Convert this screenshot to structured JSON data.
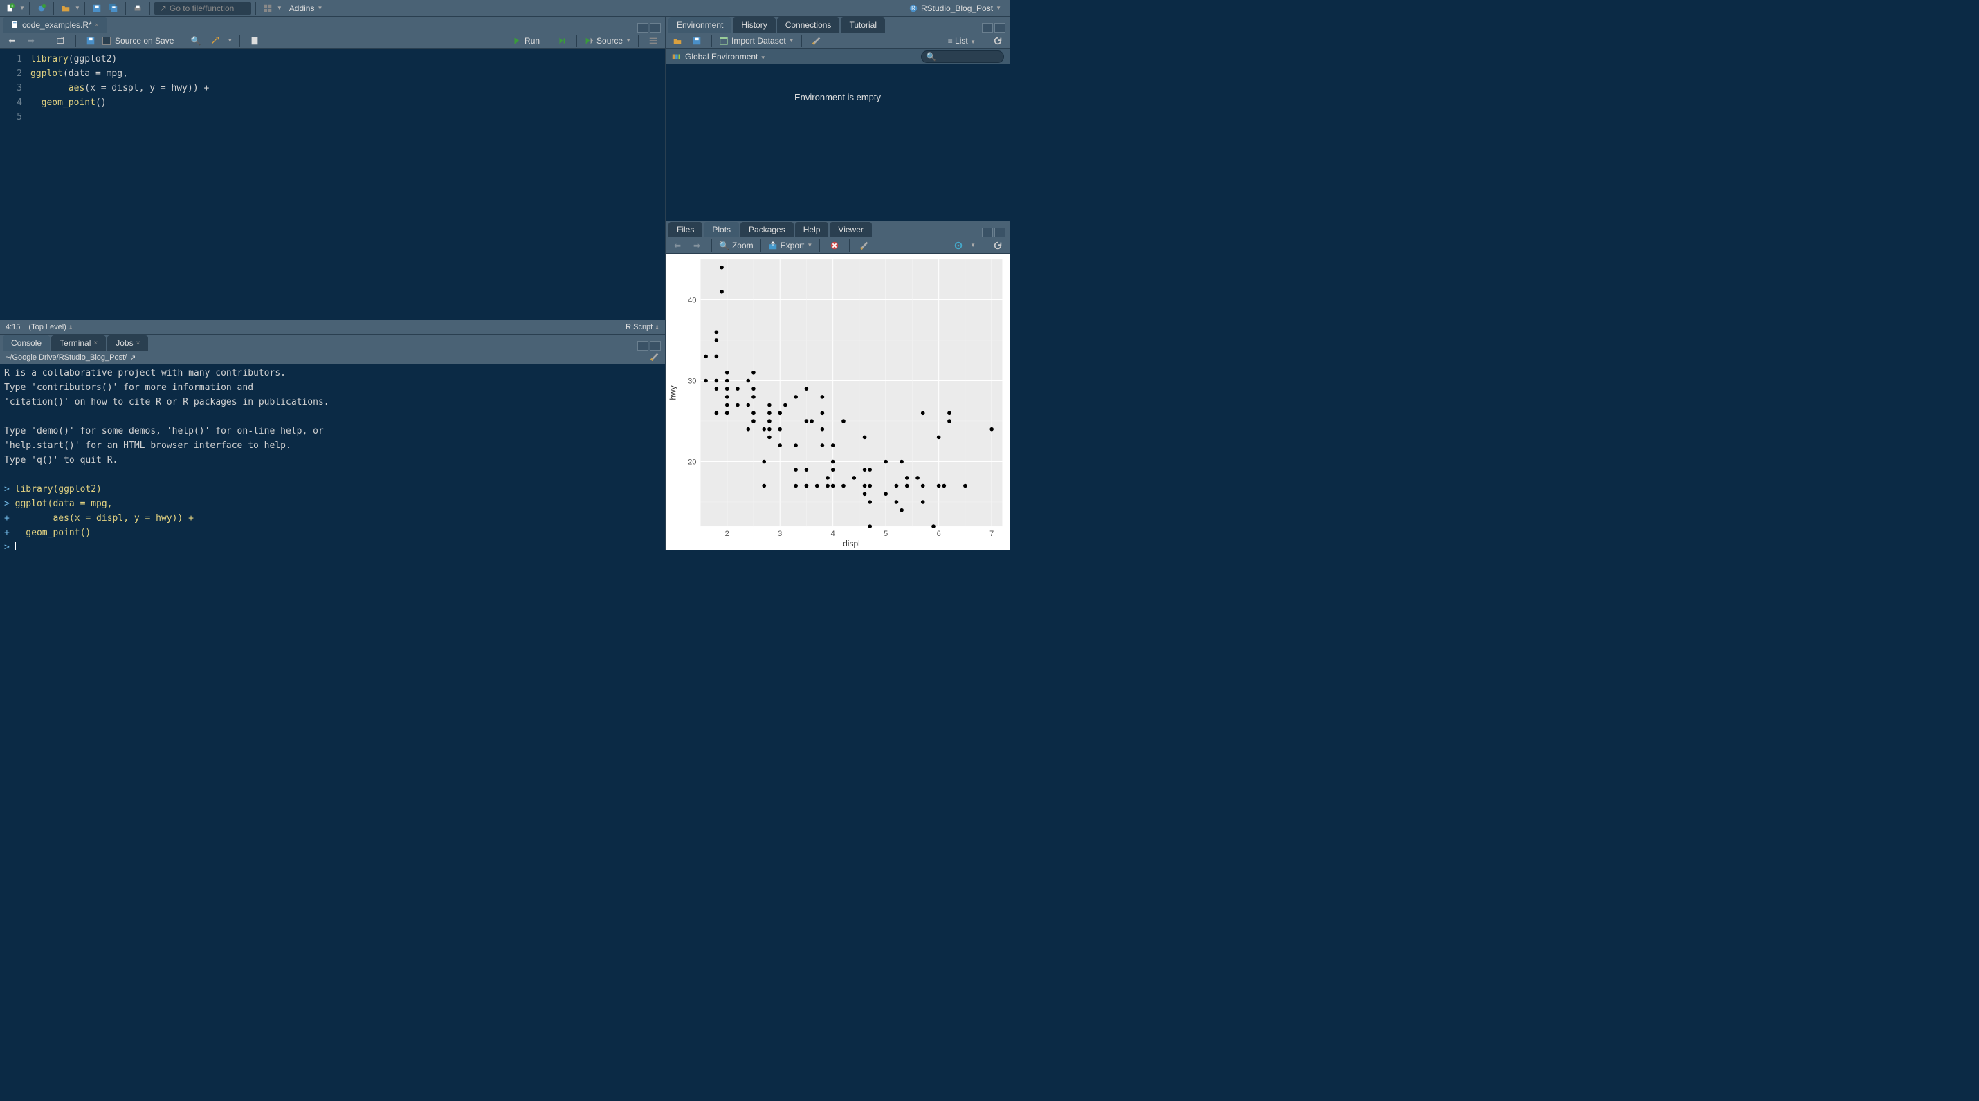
{
  "project": {
    "name": "RStudio_Blog_Post"
  },
  "main_toolbar": {
    "goto_placeholder": "Go to file/function",
    "addins_label": "Addins"
  },
  "source": {
    "tab_label": "code_examples.R*",
    "source_on_save": "Source on Save",
    "run_label": "Run",
    "source_label": "Source",
    "status_pos": "4:15",
    "status_scope": "(Top Level)",
    "status_type": "R Script",
    "lines": [
      {
        "n": 1,
        "tokens": [
          [
            "fn",
            "library"
          ],
          [
            "op",
            "("
          ],
          [
            "d",
            "ggplot2"
          ],
          [
            "op",
            ")"
          ]
        ]
      },
      {
        "n": 2,
        "tokens": [
          [
            "fn",
            "ggplot"
          ],
          [
            "op",
            "("
          ],
          [
            "d",
            "data "
          ],
          [
            "op",
            "="
          ],
          [
            "d",
            " mpg"
          ],
          [
            "op",
            ","
          ]
        ]
      },
      {
        "n": 3,
        "tokens": [
          [
            "d",
            "       "
          ],
          [
            "fn",
            "aes"
          ],
          [
            "op",
            "("
          ],
          [
            "d",
            "x "
          ],
          [
            "op",
            "="
          ],
          [
            "d",
            " displ"
          ],
          [
            "op",
            ","
          ],
          [
            "d",
            " y "
          ],
          [
            "op",
            "="
          ],
          [
            "d",
            " hwy"
          ],
          [
            "op",
            "))"
          ],
          [
            "d",
            " "
          ],
          [
            "op",
            "+"
          ]
        ]
      },
      {
        "n": 4,
        "tokens": [
          [
            "d",
            "  "
          ],
          [
            "fn",
            "geom_point"
          ],
          [
            "op",
            "()"
          ]
        ]
      },
      {
        "n": 5,
        "tokens": []
      }
    ]
  },
  "console": {
    "tabs": [
      "Console",
      "Terminal",
      "Jobs"
    ],
    "path": "~/Google Drive/RStudio_Blog_Post/",
    "body_plain": "R is a collaborative project with many contributors.\nType 'contributors()' for more information and\n'citation()' on how to cite R or R packages in publications.\n\nType 'demo()' for some demos, 'help()' for on-line help, or\n'help.start()' for an HTML browser interface to help.\nType 'q()' to quit R.\n",
    "cmds": [
      {
        "p": ">",
        "t": "library(ggplot2)"
      },
      {
        "p": ">",
        "t": "ggplot(data = mpg,"
      },
      {
        "p": "+",
        "t": "       aes(x = displ, y = hwy)) +"
      },
      {
        "p": "+",
        "t": "  geom_point()"
      }
    ]
  },
  "env": {
    "tabs": [
      "Environment",
      "History",
      "Connections",
      "Tutorial"
    ],
    "import_label": "Import Dataset",
    "list_label": "List",
    "scope": "Global Environment",
    "empty_msg": "Environment is empty"
  },
  "plots": {
    "tabs": [
      "Files",
      "Plots",
      "Packages",
      "Help",
      "Viewer"
    ],
    "zoom_label": "Zoom",
    "export_label": "Export"
  },
  "chart_data": {
    "type": "scatter",
    "title": "",
    "xlabel": "displ",
    "ylabel": "hwy",
    "xlim": [
      1.5,
      7.2
    ],
    "ylim": [
      12,
      45
    ],
    "xticks": [
      2,
      3,
      4,
      5,
      6,
      7
    ],
    "yticks": [
      20,
      30,
      40
    ],
    "points": [
      [
        1.6,
        33
      ],
      [
        1.6,
        30
      ],
      [
        1.8,
        36
      ],
      [
        1.8,
        29
      ],
      [
        1.8,
        30
      ],
      [
        1.8,
        33
      ],
      [
        1.8,
        35
      ],
      [
        1.8,
        26
      ],
      [
        1.9,
        44
      ],
      [
        1.9,
        41
      ],
      [
        2.0,
        31
      ],
      [
        2.0,
        29
      ],
      [
        2.0,
        30
      ],
      [
        2.0,
        28
      ],
      [
        2.0,
        26
      ],
      [
        2.0,
        29
      ],
      [
        2.0,
        27
      ],
      [
        2.0,
        26
      ],
      [
        2.2,
        27
      ],
      [
        2.2,
        29
      ],
      [
        2.4,
        30
      ],
      [
        2.4,
        27
      ],
      [
        2.4,
        24
      ],
      [
        2.5,
        26
      ],
      [
        2.5,
        28
      ],
      [
        2.5,
        25
      ],
      [
        2.5,
        29
      ],
      [
        2.5,
        31
      ],
      [
        2.7,
        24
      ],
      [
        2.7,
        20
      ],
      [
        2.7,
        17
      ],
      [
        2.8,
        26
      ],
      [
        2.8,
        25
      ],
      [
        2.8,
        27
      ],
      [
        2.8,
        23
      ],
      [
        2.8,
        24
      ],
      [
        3.0,
        26
      ],
      [
        3.0,
        24
      ],
      [
        3.0,
        22
      ],
      [
        3.1,
        27
      ],
      [
        3.3,
        28
      ],
      [
        3.3,
        22
      ],
      [
        3.3,
        17
      ],
      [
        3.3,
        19
      ],
      [
        3.5,
        29
      ],
      [
        3.5,
        25
      ],
      [
        3.5,
        17
      ],
      [
        3.5,
        19
      ],
      [
        3.6,
        25
      ],
      [
        3.7,
        17
      ],
      [
        3.8,
        26
      ],
      [
        3.8,
        28
      ],
      [
        3.8,
        24
      ],
      [
        3.8,
        22
      ],
      [
        3.9,
        17
      ],
      [
        3.9,
        18
      ],
      [
        4.0,
        20
      ],
      [
        4.0,
        17
      ],
      [
        4.0,
        19
      ],
      [
        4.0,
        22
      ],
      [
        4.2,
        17
      ],
      [
        4.2,
        25
      ],
      [
        4.4,
        18
      ],
      [
        4.6,
        19
      ],
      [
        4.6,
        16
      ],
      [
        4.6,
        17
      ],
      [
        4.6,
        23
      ],
      [
        4.7,
        12
      ],
      [
        4.7,
        17
      ],
      [
        4.7,
        19
      ],
      [
        4.7,
        15
      ],
      [
        5.0,
        16
      ],
      [
        5.0,
        20
      ],
      [
        5.2,
        17
      ],
      [
        5.2,
        15
      ],
      [
        5.3,
        20
      ],
      [
        5.3,
        14
      ],
      [
        5.4,
        17
      ],
      [
        5.4,
        18
      ],
      [
        5.6,
        18
      ],
      [
        5.7,
        26
      ],
      [
        5.7,
        17
      ],
      [
        5.7,
        15
      ],
      [
        5.9,
        12
      ],
      [
        6.0,
        17
      ],
      [
        6.0,
        23
      ],
      [
        6.1,
        17
      ],
      [
        6.2,
        25
      ],
      [
        6.2,
        26
      ],
      [
        6.5,
        17
      ],
      [
        7.0,
        24
      ]
    ]
  }
}
